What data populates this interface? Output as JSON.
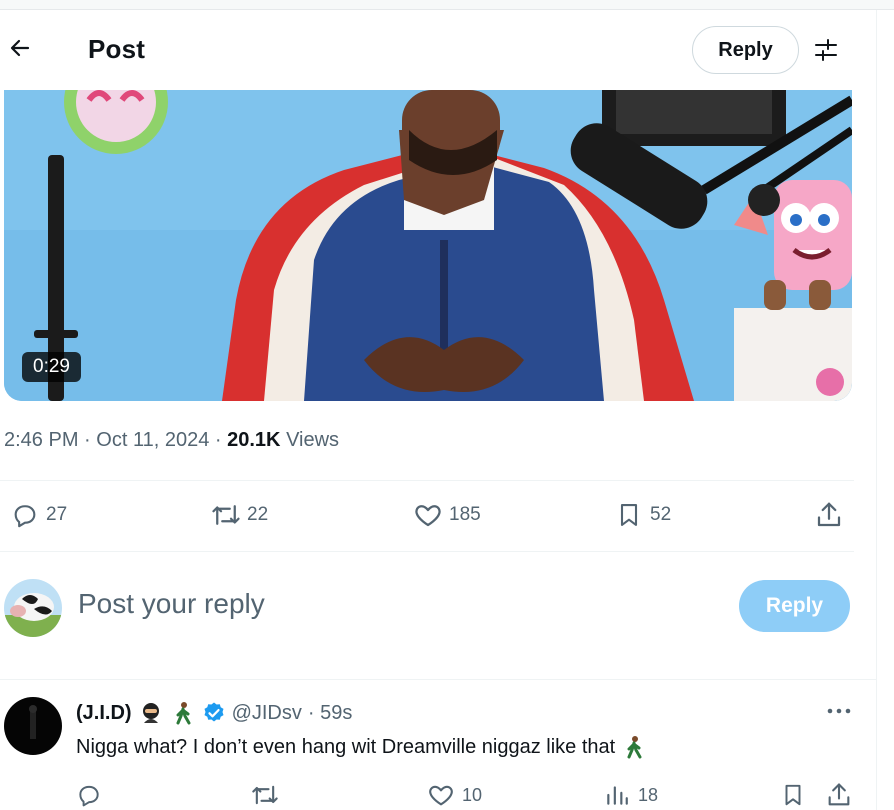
{
  "header": {
    "title": "Post",
    "reply_button": "Reply",
    "back_icon": "arrow-left-icon",
    "filter_icon": "tune-icon"
  },
  "video": {
    "duration": "0:29"
  },
  "post_meta": {
    "time": "2:46 PM",
    "separator": "·",
    "date": "Oct 11, 2024",
    "views_count": "20.1K",
    "views_label": "Views"
  },
  "actions": {
    "replies": "27",
    "reposts": "22",
    "likes": "185",
    "bookmarks": "52"
  },
  "compose": {
    "placeholder": "Post your reply",
    "reply_button": "Reply"
  },
  "reply_tweet": {
    "name": "(J.I.D)",
    "handle": "@JIDsv",
    "time": "· 59s",
    "text": "Nigga what? I don’t even hang wit Dreamville niggaz like that",
    "replies": "",
    "reposts": "",
    "likes": "10",
    "views": "18"
  },
  "colors": {
    "accent": "#1d9bf0",
    "reply_disabled": "#8ecdf7",
    "muted_text": "#536471",
    "text": "#0f1419"
  }
}
